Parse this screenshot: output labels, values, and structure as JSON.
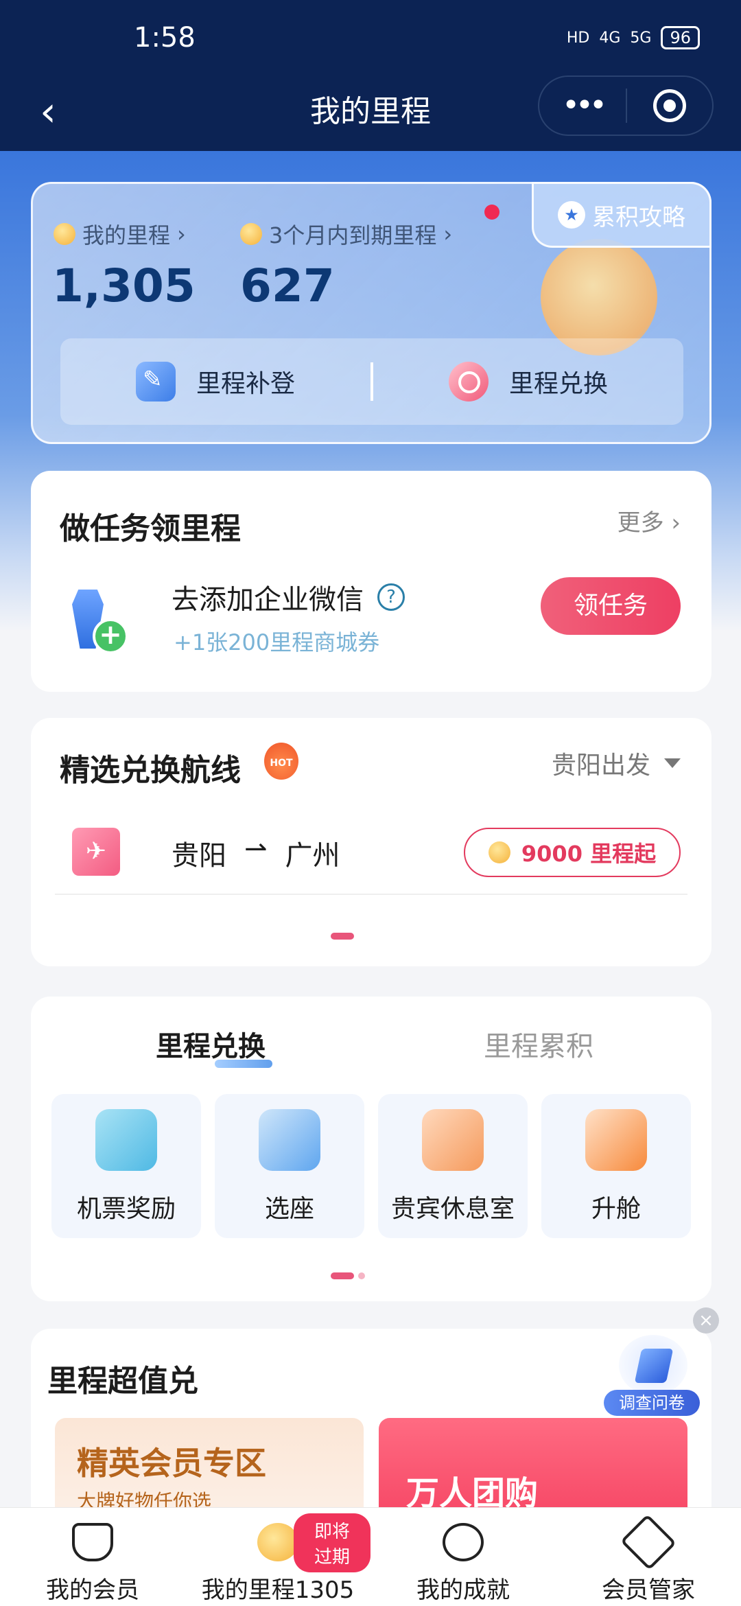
{
  "status_bar": {
    "time": "1:58",
    "hd": "HD",
    "net1": "4G",
    "net2": "5G",
    "battery": "96"
  },
  "nav": {
    "title": "我的里程"
  },
  "miles": {
    "my_label": "我的里程",
    "my_value": "1,305",
    "expire_label": "3个月内到期里程",
    "expire_value": "627",
    "guide_label": "累积攻略",
    "action_claim": "里程补登",
    "action_redeem": "里程兑换"
  },
  "task": {
    "title": "做任务领里程",
    "more": "更多",
    "name": "去添加企业微信",
    "reward": "+1张200里程商城券",
    "button": "领任务"
  },
  "routes": {
    "title": "精选兑换航线",
    "hot_badge": "HOT",
    "departure": "贵阳出发",
    "from": "贵阳",
    "arrow": "⇀",
    "to": "广州",
    "miles": "9000 里程起"
  },
  "exchange": {
    "tab_active": "里程兑换",
    "tab_inactive": "里程累积",
    "tiles": [
      {
        "label": "机票奖励",
        "icon": "ticket-gift-icon"
      },
      {
        "label": "选座",
        "icon": "seat-icon"
      },
      {
        "label": "贵宾休息室",
        "icon": "sofa-icon"
      },
      {
        "label": "升舱",
        "icon": "upgrade-seat-icon"
      }
    ]
  },
  "super": {
    "title": "里程超值兑",
    "banner1_title": "精英会员专区",
    "banner1_sub": "大牌好物任你选",
    "banner2_title": "万人团购"
  },
  "survey": {
    "label": "调查问卷"
  },
  "tabbar": {
    "items": [
      {
        "label": "我的会员",
        "icon": "crown-icon"
      },
      {
        "label": "我的里程1305",
        "icon": "coins-icon"
      },
      {
        "label": "我的成就",
        "icon": "medal-icon"
      },
      {
        "label": "会员管家",
        "icon": "plane-badge-icon"
      }
    ],
    "badge": "即将过期"
  },
  "colors": {
    "nav_bg": "#0c2354",
    "accent_red": "#ee3f63",
    "miles_blue": "#0d3874"
  }
}
